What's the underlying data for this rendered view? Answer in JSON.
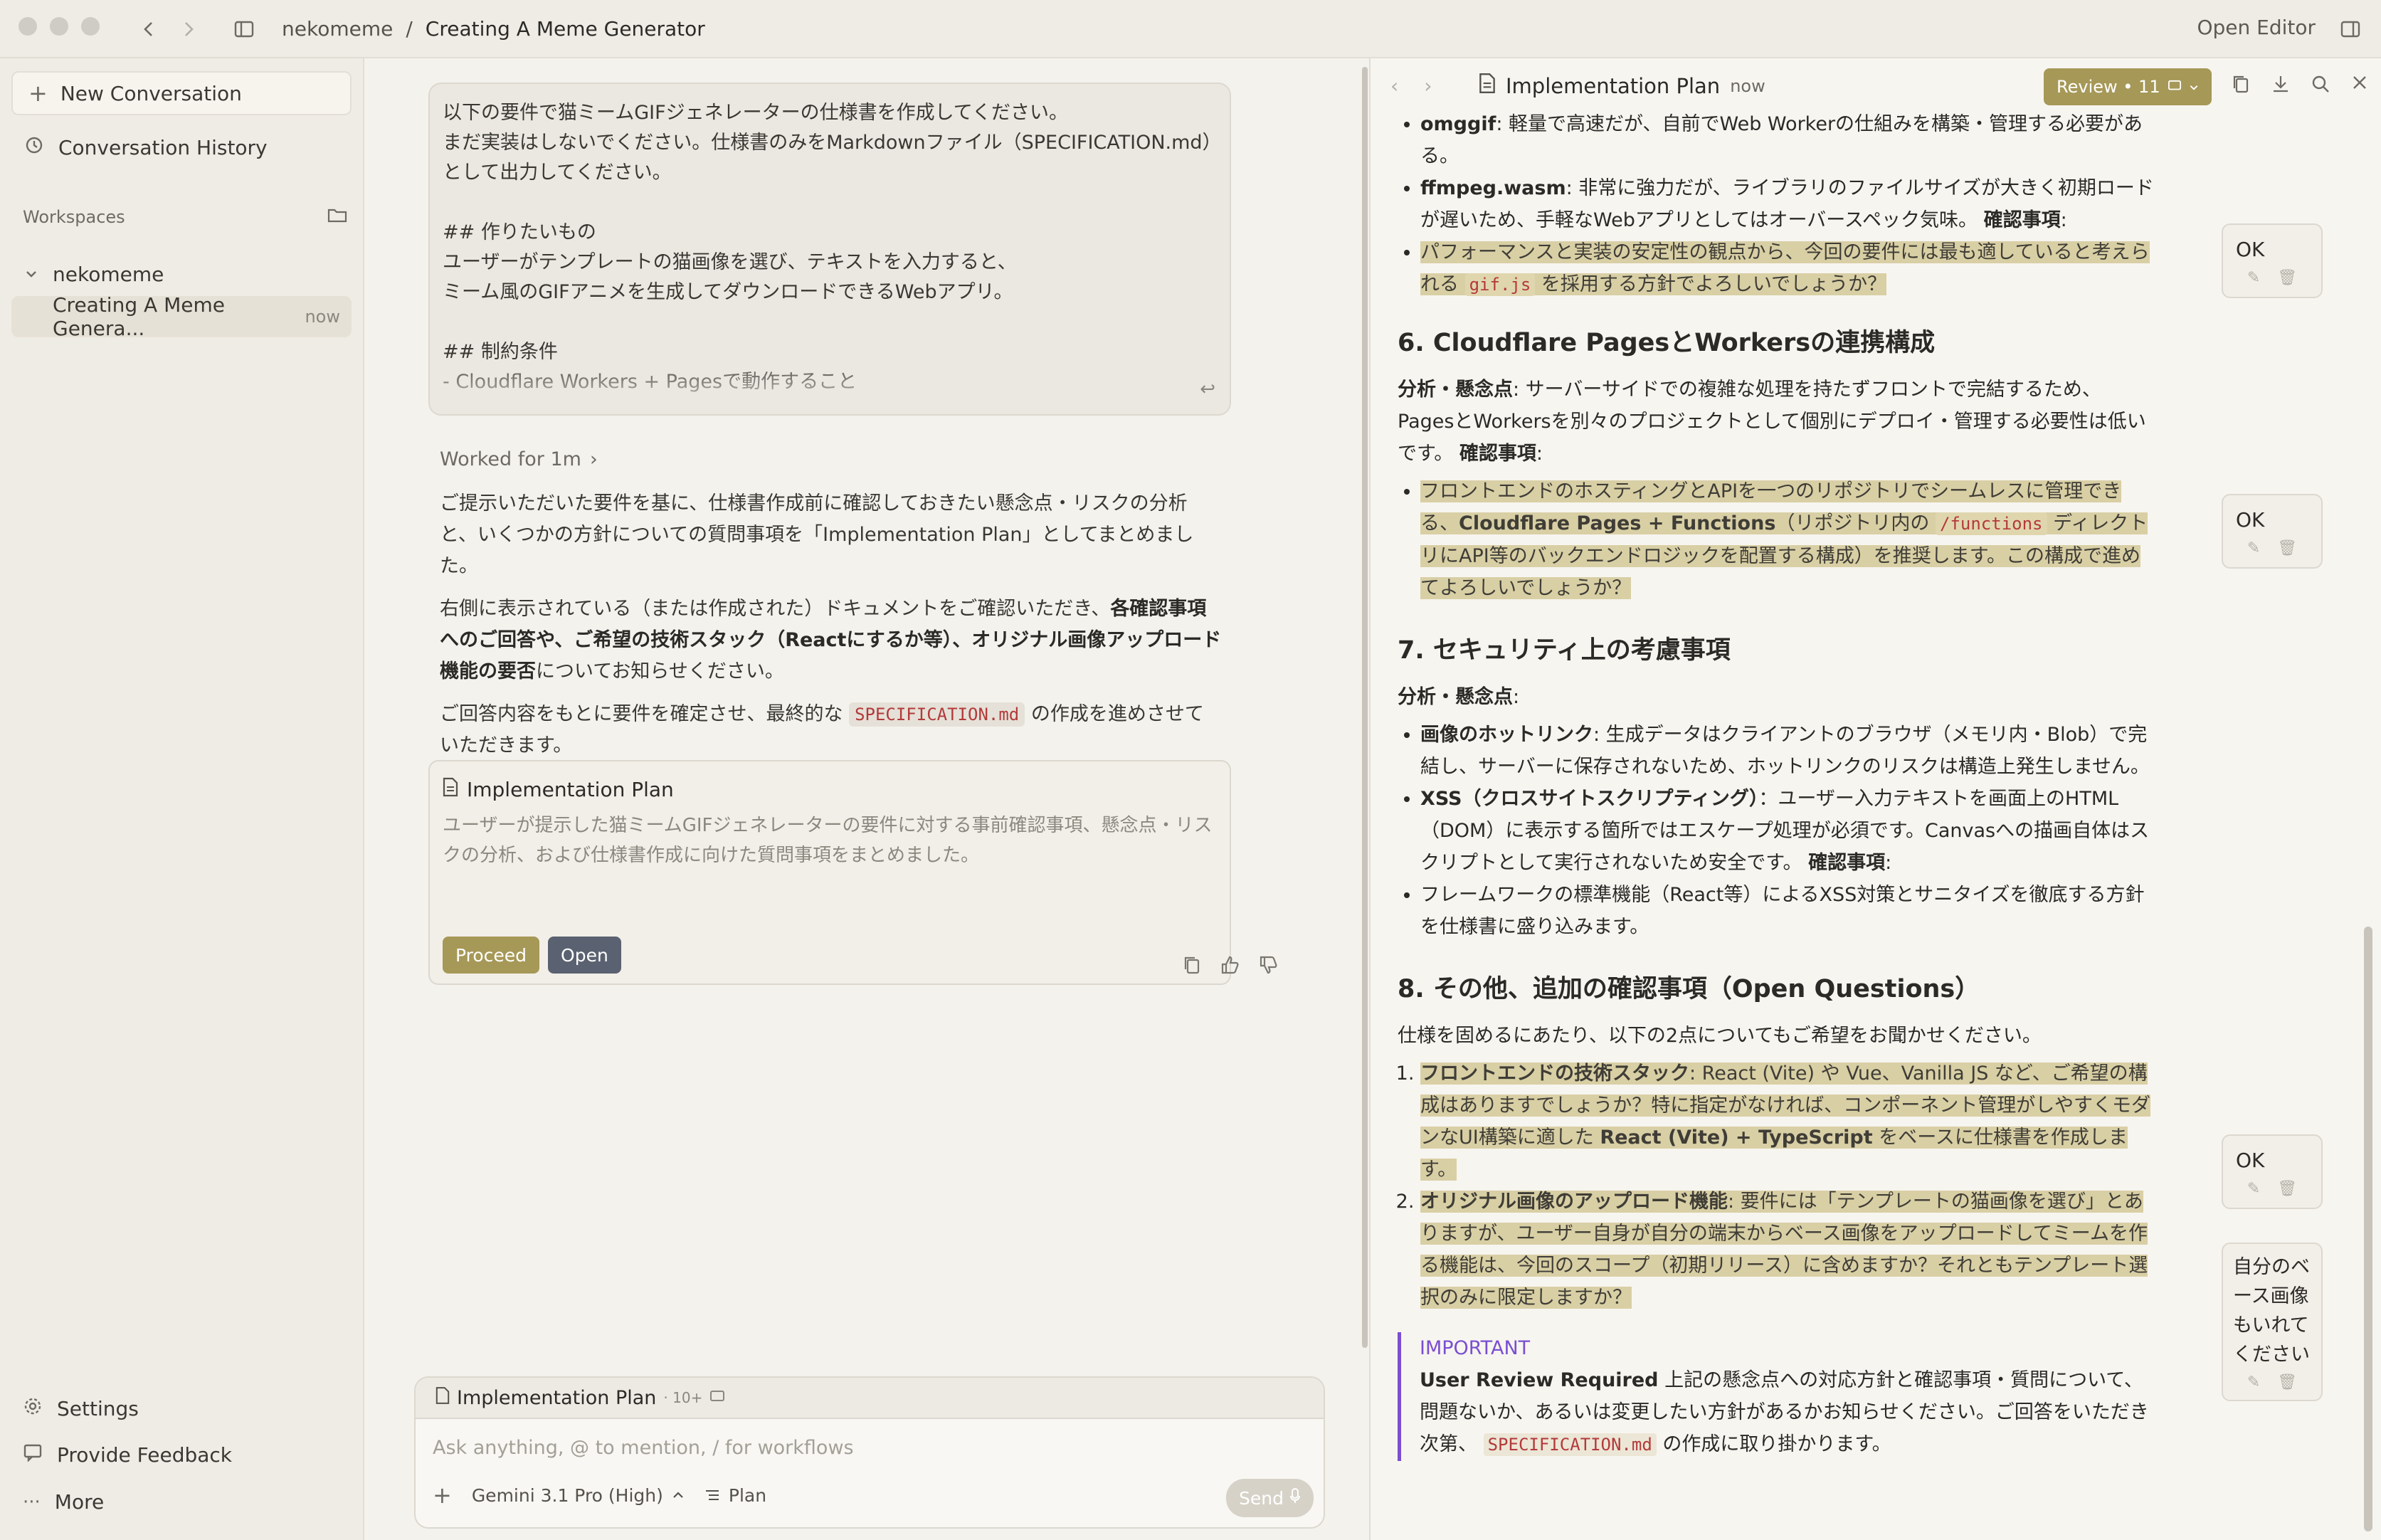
{
  "titlebar": {
    "breadcrumb_root": "nekomeme",
    "breadcrumb_sep": "/",
    "breadcrumb_current": "Creating A Meme Generator",
    "open_editor": "Open Editor"
  },
  "sidebar": {
    "new_conversation": "New Conversation",
    "conversation_history": "Conversation History",
    "workspaces_label": "Workspaces",
    "workspace_name": "nekomeme",
    "conversation_item": "Creating A Meme Genera...",
    "conversation_time": "now",
    "settings": "Settings",
    "provide_feedback": "Provide Feedback",
    "more": "More"
  },
  "chat": {
    "user_prompt": "以下の要件で猫ミームGIFジェネレーターの仕様書を作成してください。\nまだ実装はしないでください。仕様書のみをMarkdownファイル（SPECIFICATION.md）\nとして出力してください。\n\n## 作りたいもの\nユーザーがテンプレートの猫画像を選び、テキストを入力すると、\nミーム風のGIFアニメを生成してダウンロードできるWebアプリ。\n\n## 制約条件\n- Cloudflare Workers + Pagesで動作すること",
    "worked_for": "Worked for 1m",
    "answer_p1": "ご提示いただいた要件を基に、仕様書作成前に確認しておきたい懸念点・リスクの分析と、いくつかの方針についての質問事項を「Implementation Plan」としてまとめました。",
    "answer_p2_pre": "右側に表示されている（または作成された）ドキュメントをご確認いただき、",
    "answer_p2_bold": "各確認事項へのご回答や、ご希望の技術スタック（Reactにするか等）、オリジナル画像アップロード機能の要否",
    "answer_p2_post": "についてお知らせください。",
    "answer_p3_pre": "ご回答内容をもとに要件を確定させ、最終的な",
    "answer_p3_code": "SPECIFICATION.md",
    "answer_p3_post": "の作成を進めさせていただきます。",
    "plan_card": {
      "title": "Implementation Plan",
      "description": "ユーザーが提示した猫ミームGIFジェネレーターの要件に対する事前確認事項、懸念点・リスクの分析、および仕様書作成に向けた質問事項をまとめました。",
      "proceed": "Proceed",
      "open": "Open"
    }
  },
  "composer": {
    "context_title": "Implementation Plan",
    "context_count": "· 10+",
    "placeholder": "Ask anything, @ to mention, / for workflows",
    "model": "Gemini 3.1 Pro (High)",
    "mode": "Plan",
    "send": "Send"
  },
  "right_pane": {
    "title": "Implementation Plan",
    "time": "now",
    "review_label": "Review • 11",
    "doc": {
      "b1_bold": "omggif",
      "b1_text": ": 軽量で高速だが、自前でWeb Workerの仕組みを構築・管理する必要がある。",
      "b2_bold": "ffmpeg.wasm",
      "b2_text": ": 非常に強力だが、ライブラリのファイルサイズが大きく初期ロードが遅いため、手軽なWebアプリとしてはオーバースペック気味。",
      "confirm_label": "確認事項",
      "q1_pre": "パフォーマンスと実装の安定性の観点から、今回の要件には最も適していると考えられる",
      "q1_code": "gif.js",
      "q1_post": "を採用する方針でよろしいでしょうか？",
      "h6": "6. Cloudflare PagesとWorkersの連携構成",
      "analysis_label": "分析・懸念点",
      "s6_text": ": サーバーサイドでの複雑な処理を持たずフロントで完結するため、PagesとWorkersを別々のプロジェクトとして個別にデプロイ・管理する必要性は低いです。",
      "q6_pre": "フロントエンドのホスティングとAPIを一つのリポジトリでシームレスに管理できる、",
      "q6_bold": "Cloudflare Pages + Functions",
      "q6_mid": "（リポジトリ内の",
      "q6_code": "/functions",
      "q6_post": "ディレクトリにAPI等のバックエンドロジックを配置する構成）を推奨します。この構成で進めてよろしいでしょうか？",
      "h7": "7. セキュリティ上の考慮事項",
      "s7_b1_bold": "画像のホットリンク",
      "s7_b1_text": ": 生成データはクライアントのブラウザ（メモリ内・Blob）で完結し、サーバーに保存されないため、ホットリンクのリスクは構造上発生しません。",
      "s7_b2_bold": "XSS（クロスサイトスクリプティング）",
      "s7_b2_text": "：ユーザー入力テキストを画面上のHTML（DOM）に表示する箇所ではエスケープ処理が必須です。Canvasへの描画自体はスクリプトとして実行されないため安全です。",
      "s7_b3": "フレームワークの標準機能（React等）によるXSS対策とサニタイズを徹底する方針を仕様書に盛り込みます。",
      "h8": "8. その他、追加の確認事項（Open Questions）",
      "s8_intro": "仕様を固めるにあたり、以下の2点についてもご希望をお聞かせください。",
      "s8_q1_bold": "フロントエンドの技術スタック",
      "s8_q1_text": ": React (Vite) や Vue、Vanilla JS など、ご希望の構成はありますでしょうか？特に指定がなければ、コンポーネント管理がしやすくモダンなUI構築に適した",
      "s8_q1_bold2": "React (Vite) + TypeScript",
      "s8_q1_post": "をベースに仕様書を作成します。",
      "s8_q2_bold": "オリジナル画像のアップロード機能",
      "s8_q2_text": ": 要件には「テンプレートの猫画像を選び」とありますが、ユーザー自身が自分の端末からベース画像をアップロードしてミームを作る機能は、今回のスコープ（初期リリース）に含めますか？それともテンプレート選択のみに限定しますか？",
      "important_label": "IMPORTANT",
      "important_bold": "User Review Required",
      "important_text_pre": "上記の懸念点への対応方針と確認事項・質問について、問題ないか、あるいは変更したい方針があるかお知らせください。ご回答をいただき次第、",
      "important_code": "SPECIFICATION.md",
      "important_text_post": "の作成に取り掛かります。"
    },
    "comments": [
      "OK",
      "OK",
      "OK",
      "自分のベース画像もいれてください"
    ]
  }
}
